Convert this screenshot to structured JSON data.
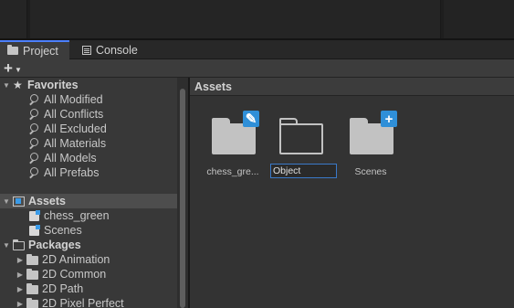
{
  "tabs": [
    {
      "label": "Project",
      "active": true
    },
    {
      "label": "Console",
      "active": false
    }
  ],
  "toolbar": {
    "add_label": "+"
  },
  "sidebar": {
    "favorites": {
      "label": "Favorites",
      "items": [
        "All Modified",
        "All Conflicts",
        "All Excluded",
        "All Materials",
        "All Models",
        "All Prefabs"
      ]
    },
    "assets": {
      "label": "Assets",
      "items": [
        "chess_green",
        "Scenes"
      ]
    },
    "packages": {
      "label": "Packages",
      "items": [
        "2D Animation",
        "2D Common",
        "2D Path",
        "2D Pixel Perfect"
      ]
    }
  },
  "main": {
    "breadcrumb": "Assets",
    "items": [
      {
        "name": "chess_gre...",
        "badge": "edit-icon"
      },
      {
        "name": "",
        "rename_value": "Object"
      },
      {
        "name": "Scenes",
        "badge": "plus-icon"
      }
    ]
  },
  "colors": {
    "accent": "#2f8fd8",
    "selection": "#4d4d4d",
    "tab_accent": "#4c7fff"
  }
}
